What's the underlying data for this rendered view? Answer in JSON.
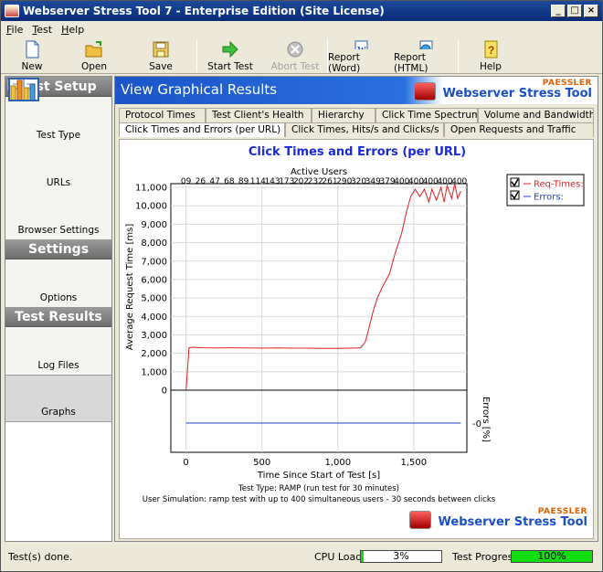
{
  "window": {
    "title": "Webserver Stress Tool 7 - Enterprise Edition (Site License)"
  },
  "menu": [
    "File",
    "Test",
    "Help"
  ],
  "toolbar": {
    "new": "New",
    "open": "Open",
    "save": "Save",
    "start": "Start Test",
    "abort": "Abort Test",
    "report_word": "Report (Word)",
    "report_html": "Report (HTML)",
    "help": "Help"
  },
  "sidebar": {
    "setup_header": "Test Setup",
    "settings_header": "Settings",
    "results_header": "Test Results",
    "test_type": "Test Type",
    "urls": "URLs",
    "browser_settings": "Browser Settings",
    "options": "Options",
    "log_files": "Log Files",
    "graphs": "Graphs"
  },
  "main": {
    "header": "View Graphical Results",
    "brand_small": "PAESSLER",
    "brand_name": "Webserver Stress Tool",
    "tabs_row1": [
      "Protocol Times",
      "Test Client's Health",
      "Hierarchy",
      "Click Time Spectrum",
      "Volume and Bandwidth"
    ],
    "tabs_row2": [
      "Click Times and Errors (per URL)",
      "Click Times, Hits/s and Clicks/s",
      "Open Requests and Traffic"
    ],
    "active_tab": "Click Times and Errors (per URL)"
  },
  "chart_data": {
    "type": "line",
    "title": "Click Times and Errors (per URL)",
    "top_axis_label": "Active Users",
    "top_axis_ticks": [
      "09",
      "26",
      "47",
      "68",
      "89",
      "114",
      "143",
      "173",
      "202",
      "232",
      "261",
      "290",
      "320",
      "349",
      "379",
      "400",
      "400",
      "400",
      "400",
      "400"
    ],
    "xlabel": "Time Since Start of Test [s]",
    "ylabel": "Average Request Time [ms]",
    "y2label": "Errors [%]",
    "xlim": [
      -100,
      1850
    ],
    "ylim": [
      0,
      11200
    ],
    "xticks": [
      0,
      500,
      1000,
      1500
    ],
    "xtick_labels": [
      "0",
      "500",
      "1,000",
      "1,500"
    ],
    "yticks": [
      0,
      1000,
      2000,
      3000,
      4000,
      5000,
      6000,
      7000,
      8000,
      9000,
      10000,
      11000
    ],
    "ytick_labels": [
      "0",
      "1,000",
      "2,000",
      "3,000",
      "4,000",
      "5,000",
      "6,000",
      "7,000",
      "8,000",
      "9,000",
      "10,000",
      "11,000"
    ],
    "y2_tick_label": "0",
    "grid": true,
    "legend_position": "right",
    "series": [
      {
        "name": "Req-Times:",
        "color": "#e02020",
        "x": [
          0,
          20,
          40,
          100,
          200,
          300,
          400,
          500,
          600,
          700,
          800,
          900,
          1000,
          1100,
          1150,
          1180,
          1200,
          1230,
          1260,
          1300,
          1340,
          1380,
          1420,
          1450,
          1480,
          1510,
          1540,
          1570,
          1600,
          1620,
          1650,
          1680,
          1700,
          1720,
          1750,
          1770,
          1790,
          1810
        ],
        "y": [
          0,
          2300,
          2330,
          2300,
          2290,
          2300,
          2290,
          2280,
          2290,
          2280,
          2280,
          2270,
          2270,
          2280,
          2300,
          2600,
          3200,
          4200,
          5000,
          5700,
          6300,
          7500,
          8500,
          9600,
          10500,
          10900,
          10500,
          10900,
          10200,
          10900,
          10300,
          11000,
          10200,
          11100,
          10400,
          11200,
          10400,
          10800
        ]
      },
      {
        "name": "Errors:",
        "color": "#2040d0",
        "x": [
          0,
          1810
        ],
        "y": [
          0,
          0
        ]
      }
    ],
    "footer_line1": "Test Type: RAMP (run test for 30 minutes)",
    "footer_line2": "User Simulation: ramp test with up to 400 simultaneous users - 30 seconds between clicks"
  },
  "status": {
    "text": "Test(s) done.",
    "cpu_label": "CPU Load:",
    "cpu_value": "3%",
    "cpu_fraction": 0.03,
    "progress_label": "Test Progress:",
    "progress_value": "100%",
    "progress_fraction": 1.0
  }
}
